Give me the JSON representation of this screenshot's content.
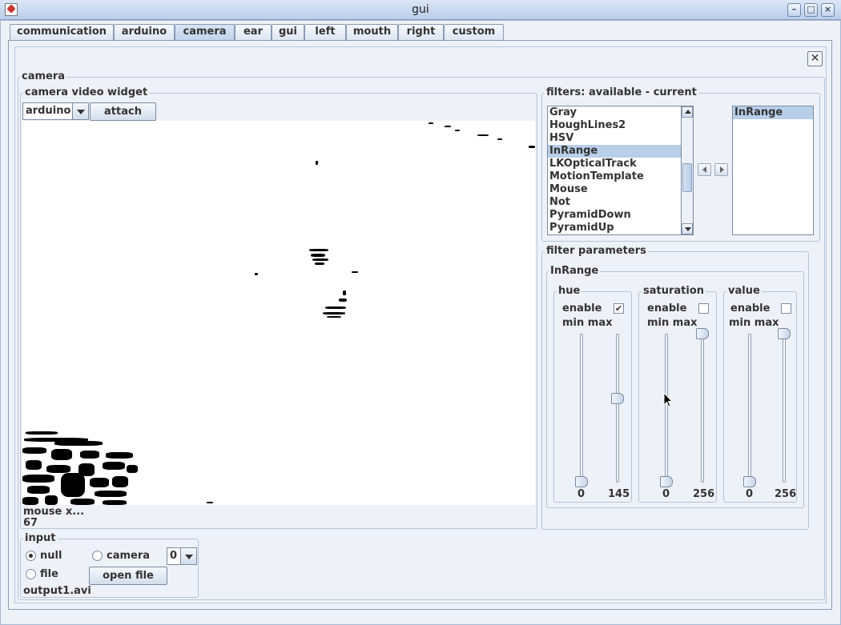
{
  "window": {
    "title": "gui"
  },
  "tabs": [
    {
      "label": "communication",
      "active": false
    },
    {
      "label": "arduino",
      "active": false
    },
    {
      "label": "camera",
      "active": true
    },
    {
      "label": "ear",
      "active": false
    },
    {
      "label": "gui",
      "active": false
    },
    {
      "label": "left",
      "active": false
    },
    {
      "label": "mouth",
      "active": false
    },
    {
      "label": "right",
      "active": false
    },
    {
      "label": "custom",
      "active": false
    }
  ],
  "panel": {
    "title": "camera",
    "close_symbol": "✕"
  },
  "video_widget": {
    "title": "camera  video widget",
    "source_value": "arduino",
    "attach_label": "attach",
    "mouse_label": "mouse x...",
    "mouse_value": "67"
  },
  "filters": {
    "title": "filters: available - current",
    "available": [
      "Gray",
      "HoughLines2",
      "HSV",
      "InRange",
      "LKOpticalTrack",
      "MotionTemplate",
      "Mouse",
      "Not",
      "PyramidDown",
      "PyramidUp"
    ],
    "selected_available": "InRange",
    "current": [
      "InRange"
    ],
    "scroll_position": 0.55
  },
  "filter_parameters": {
    "title": "filter parameters",
    "filter_name": "InRange",
    "groups": [
      {
        "title": "hue",
        "enable_label": "enable",
        "enabled": true,
        "minmax_label": "min max",
        "min_value": "0",
        "max_value": "145",
        "min_level": 0.0,
        "max_level": 0.56
      },
      {
        "title": "saturation",
        "enable_label": "enable",
        "enabled": false,
        "minmax_label": "min max",
        "min_value": "0",
        "max_value": "256",
        "min_level": 0.0,
        "max_level": 1.0
      },
      {
        "title": "value",
        "enable_label": "enable",
        "enabled": false,
        "minmax_label": "min max",
        "min_value": "0",
        "max_value": "256",
        "min_level": 0.0,
        "max_level": 1.0
      }
    ]
  },
  "input": {
    "title": "input",
    "options": [
      {
        "label": "null",
        "selected": true
      },
      {
        "label": "camera",
        "selected": false
      },
      {
        "label": "file",
        "selected": false
      }
    ],
    "camera_index": "0",
    "open_file_label": "open file",
    "filename": "output1.avi"
  },
  "colors": {
    "selection": "#b8cfe9",
    "titlebar": "#c5d6ec",
    "border": "#8a9ab4"
  }
}
